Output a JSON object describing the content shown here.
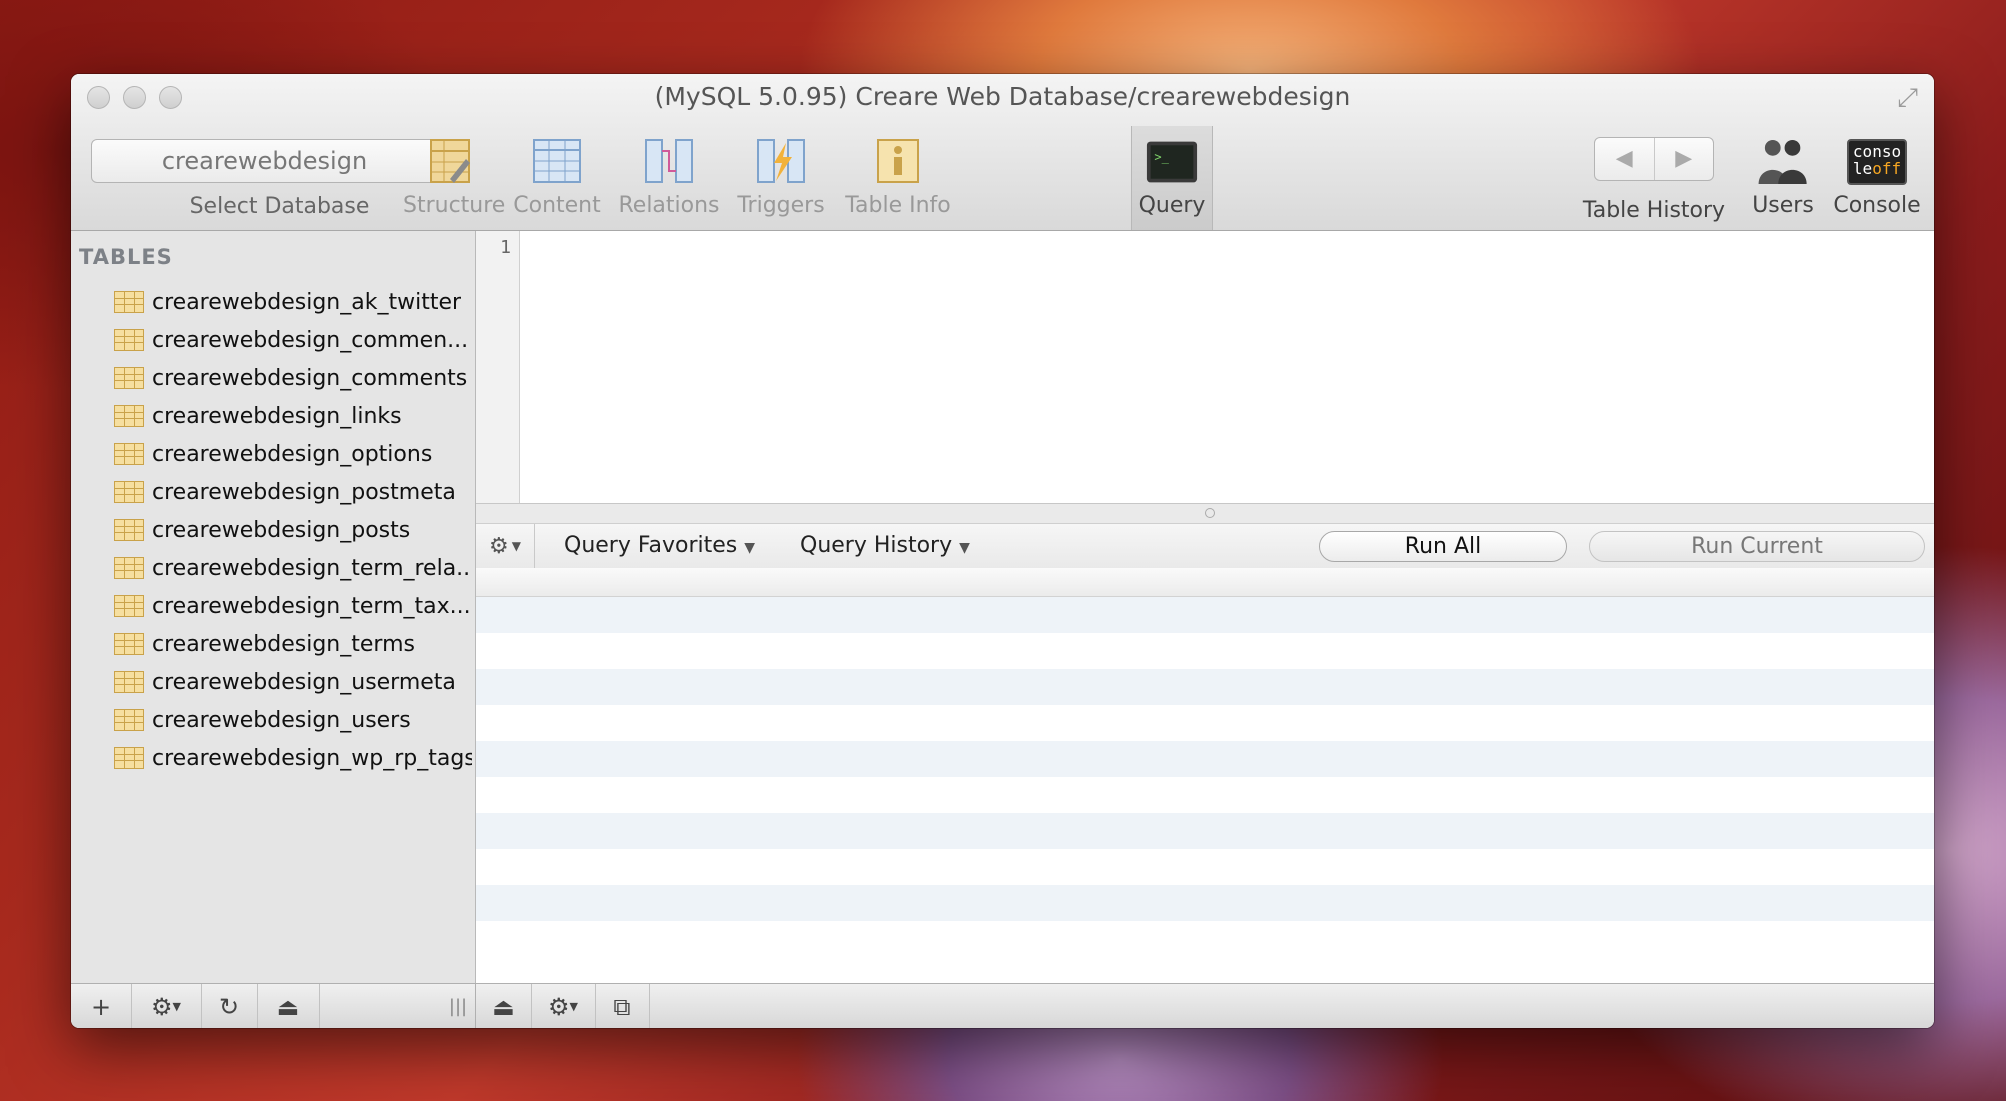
{
  "window": {
    "title": "(MySQL 5.0.95) Creare Web Database/crearewebdesign"
  },
  "toolbar": {
    "database_select": {
      "value": "crearewebdesign",
      "label": "Select Database"
    },
    "tabs": [
      {
        "label": "Structure",
        "icon": "structure-icon"
      },
      {
        "label": "Content",
        "icon": "content-icon"
      },
      {
        "label": "Relations",
        "icon": "relations-icon"
      },
      {
        "label": "Triggers",
        "icon": "triggers-icon"
      },
      {
        "label": "Table Info",
        "icon": "table-info-icon"
      },
      {
        "label": "Query",
        "icon": "query-icon",
        "active": true
      }
    ],
    "table_history_label": "Table History",
    "users_label": "Users",
    "console_label": "Console",
    "console_icon_text_1": "conso",
    "console_icon_text_2": "le",
    "console_icon_text_3": "off"
  },
  "sidebar": {
    "heading": "TABLES",
    "tables": [
      "crearewebdesign_ak_twitter",
      "crearewebdesign_commen...",
      "crearewebdesign_comments",
      "crearewebdesign_links",
      "crearewebdesign_options",
      "crearewebdesign_postmeta",
      "crearewebdesign_posts",
      "crearewebdesign_term_rela...",
      "crearewebdesign_term_tax...",
      "crearewebdesign_terms",
      "crearewebdesign_usermeta",
      "crearewebdesign_users",
      "crearewebdesign_wp_rp_tags"
    ]
  },
  "editor": {
    "line_number": "1"
  },
  "query_bar": {
    "favorites_label": "Query Favorites",
    "history_label": "Query History",
    "run_all_label": "Run All",
    "run_current_label": "Run Current"
  },
  "colors": {
    "accent_table_icon": "#f6dfa0",
    "results_stripe": "#eef3f8",
    "window_bg": "#ececec"
  }
}
